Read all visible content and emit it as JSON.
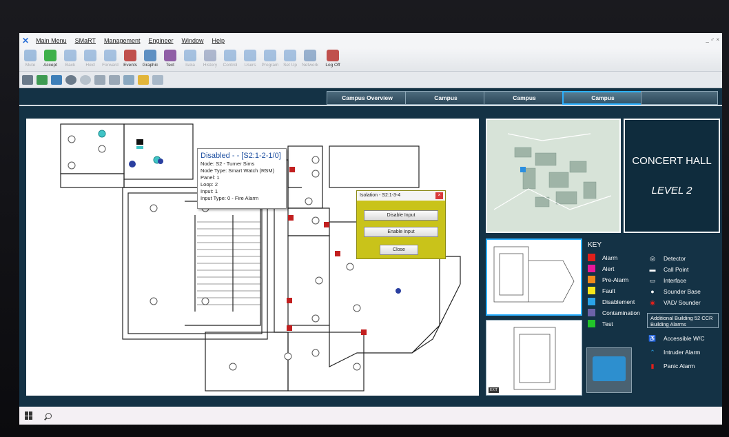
{
  "menu": {
    "items": [
      "Main Menu",
      "SMaRT",
      "Management",
      "Engineer",
      "Window",
      "Help"
    ],
    "window_controls": "_ ♂ ×"
  },
  "toolbar": {
    "buttons": [
      {
        "label": "Mute",
        "enabled": false,
        "color": "#3f7fc4"
      },
      {
        "label": "Accept",
        "enabled": true,
        "color": "#3db04a"
      },
      {
        "label": "Back",
        "enabled": false,
        "color": "#4a86c8"
      },
      {
        "label": "Hold",
        "enabled": false,
        "color": "#4a86c8"
      },
      {
        "label": "Forward",
        "enabled": false,
        "color": "#4a86c8"
      },
      {
        "label": "Events",
        "enabled": true,
        "color": "#c0504d"
      },
      {
        "label": "Graphic",
        "enabled": true,
        "color": "#5e8fc2"
      },
      {
        "label": "Text",
        "enabled": true,
        "color": "#8f5ea6"
      },
      {
        "label": "Isola",
        "enabled": false,
        "color": "#4a86c8"
      },
      {
        "label": "History",
        "enabled": false,
        "color": "#5b6fa0"
      },
      {
        "label": "Control",
        "enabled": false,
        "color": "#4a86c8"
      },
      {
        "label": "Users",
        "enabled": false,
        "color": "#4a86c8"
      },
      {
        "label": "Program",
        "enabled": false,
        "color": "#4a86c8"
      },
      {
        "label": "Set Up",
        "enabled": false,
        "color": "#4a86c8"
      },
      {
        "label": "Network",
        "enabled": false,
        "color": "#2a5fa0"
      },
      {
        "label": "Log Off",
        "enabled": true,
        "color": "#c0504d"
      }
    ]
  },
  "tabs": [
    "Campus Overview",
    "Campus",
    "Campus",
    "Campus",
    ""
  ],
  "tooltip": {
    "title": "Disabled -  - [S2:1-2-1/0]",
    "lines": [
      "Node: S2 - Turner Sims",
      "Node Type: Smart Watch (RSM)",
      "Panel: 1",
      "Loop: 2",
      "Input: 1",
      "Input Type: 0 - Fire Alarm"
    ]
  },
  "isolation": {
    "title": "Isolation - S2:1-3-4",
    "close_x": "×",
    "disable": "Disable Input",
    "enable": "Enable Input",
    "close": "Close"
  },
  "title_box": {
    "line1": "CONCERT HALL",
    "line2": "LEVEL 2"
  },
  "key": {
    "heading": "KEY",
    "statuses": [
      {
        "label": "Alarm",
        "color": "#e0201b"
      },
      {
        "label": "Alert",
        "color": "#e8179a"
      },
      {
        "label": "Pre-Alarm",
        "color": "#f08a1c"
      },
      {
        "label": "Fault",
        "color": "#f5e61b"
      },
      {
        "label": "Disablement",
        "color": "#2aa3e8"
      },
      {
        "label": "Contamination",
        "color": "#6c62a8"
      },
      {
        "label": "Test",
        "color": "#22c42a"
      }
    ],
    "devices": [
      {
        "label": "Detector",
        "icon": "detector-icon"
      },
      {
        "label": "Call Point",
        "icon": "call-point-icon"
      },
      {
        "label": "Interface",
        "icon": "interface-icon"
      },
      {
        "label": "Sounder Base",
        "icon": "sounder-base-icon"
      },
      {
        "label": "VAD/ Sounder",
        "icon": "vad-sounder-icon"
      }
    ],
    "additional": "Additional Building 52 CCR Building Alarms",
    "extras": [
      {
        "label": "Accessible W/C",
        "icon": "wheelchair-icon"
      },
      {
        "label": "Intruder Alarm",
        "icon": "intruder-icon"
      },
      {
        "label": "Panic Alarm",
        "icon": "panic-icon"
      }
    ]
  },
  "thumb_tag": "EXIT"
}
